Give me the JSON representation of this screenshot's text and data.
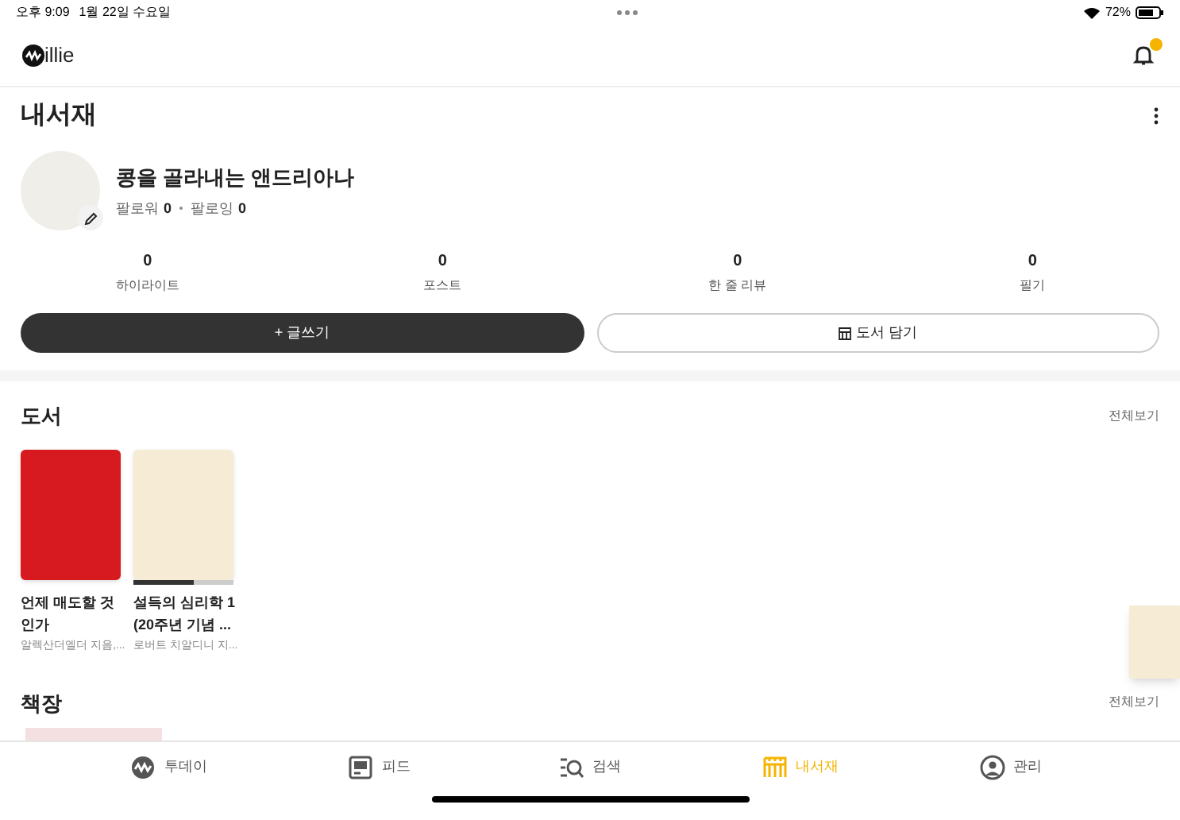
{
  "status_bar": {
    "time": "오후 9:09",
    "date": "1월 22일 수요일",
    "battery": "72%"
  },
  "header": {
    "logo_text": "illie"
  },
  "page_title": "내서재",
  "profile": {
    "name": "콩을 골라내는 앤드리아나",
    "followers_label": "팔로워",
    "followers": "0",
    "following_label": "팔로잉",
    "following": "0"
  },
  "stats": [
    {
      "value": "0",
      "label": "하이라이트"
    },
    {
      "value": "0",
      "label": "포스트"
    },
    {
      "value": "0",
      "label": "한 줄 리뷰"
    },
    {
      "value": "0",
      "label": "필기"
    }
  ],
  "actions": [
    {
      "kind": "primary",
      "label": "+ 글쓰기"
    },
    {
      "kind": "secondary",
      "label": "도서 담기"
    }
  ],
  "books_section": {
    "title": "도서",
    "see_all": "전체보기",
    "books": [
      {
        "title": "언제 매도할 것인가",
        "author": "알렉산더엘더 지음,...",
        "kind": "plain"
      },
      {
        "title": "설득의 심리학 1 (20주년 기념 ...",
        "author": "로버트 치알디니 지...",
        "kind": "in_progress",
        "level": 0.6
      }
    ]
  },
  "shelf_section": {
    "title": "책장",
    "see_all": "전체보기"
  },
  "tab_bar": [
    {
      "label": "투데이",
      "selected": false
    },
    {
      "label": "피드",
      "selected": false
    },
    {
      "label": "검색",
      "selected": false
    },
    {
      "label": "내서재",
      "selected": true
    },
    {
      "label": "관리",
      "selected": false
    }
  ]
}
